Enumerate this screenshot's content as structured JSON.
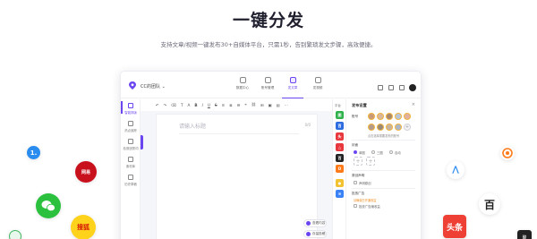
{
  "hero": {
    "title": "一键分发",
    "subtitle": "支持文章/视频一键发布30+自媒体平台，只需1秒，告别繁琐发文步骤，高效便捷。"
  },
  "app": {
    "team_name": "CC的团队",
    "nav": [
      {
        "label": "数据中心",
        "icon": "chart-icon"
      },
      {
        "label": "账号管理",
        "icon": "user-icon"
      },
      {
        "label": "发文章",
        "icon": "edit-icon",
        "active": true
      },
      {
        "label": "发视频",
        "icon": "video-icon"
      }
    ],
    "sidebar": [
      {
        "label": "智能排版",
        "icon": "text-icon",
        "active": true
      },
      {
        "label": "热点追踪",
        "icon": "fire-icon"
      },
      {
        "label": "检测违禁词",
        "icon": "shield-icon"
      },
      {
        "label": "素材库",
        "icon": "image-icon"
      },
      {
        "label": "历史草稿",
        "icon": "history-icon"
      }
    ],
    "toolbar": [
      "↶",
      "↷",
      "⌫",
      "T",
      "A",
      "B",
      "I",
      "U",
      "S",
      "≡",
      "≣",
      "☰",
      "❝",
      "⛓",
      "⊞",
      "▣",
      "▤",
      "⋯"
    ],
    "editor": {
      "title_placeholder": "请输入标题",
      "word_count": "0/0"
    },
    "float_buttons": [
      "查看内容",
      "存量投稿"
    ],
    "platform_column_header": "平台",
    "platforms": [
      {
        "label": "图",
        "color": "#2fb24c"
      },
      {
        "label": "百",
        "color": "#2d6be0"
      },
      {
        "label": "头",
        "color": "#e8383d"
      },
      {
        "label": "△",
        "color": "#e8383d"
      },
      {
        "label": "百",
        "color": "#222222"
      },
      {
        "label": "D",
        "color": "#ff7a1a"
      },
      {
        "label": "●",
        "color": "#f2c230"
      },
      {
        "label": "≡",
        "color": "#3b82f6"
      }
    ],
    "right_panel": {
      "title": "发布设置",
      "account_label": "账号",
      "account_hint": "点击选择需要发布的账号",
      "cover_label": "封面",
      "cover_options": [
        "单图",
        "三图",
        "自动"
      ],
      "original_label": "原创声明",
      "original_option": "声明原创",
      "ad_label": "投放广告",
      "ad_hint": "请确保已开通收益",
      "ad_option": "投放广告赚收益"
    }
  }
}
